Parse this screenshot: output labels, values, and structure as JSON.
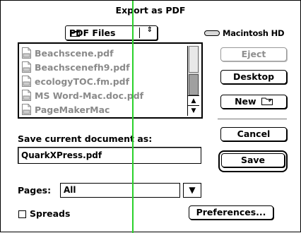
{
  "dialog": {
    "title": "Export as PDF",
    "folder_popup": {
      "selected": "PDF Files",
      "arrows": "⇕"
    },
    "volume": {
      "name": "Macintosh HD"
    },
    "files": [
      {
        "name": "Beachscene.pdf",
        "icon": "pdf-file-icon"
      },
      {
        "name": "Beachscenefh9.pdf",
        "icon": "pdf-file-icon"
      },
      {
        "name": "ecologyTOC.fm.pdf",
        "icon": "pdf-file-icon"
      },
      {
        "name": "MS Word-Mac.doc.pdf",
        "icon": "pdf-file-icon"
      },
      {
        "name": "PageMakerMac",
        "icon": "pdf-file-icon"
      }
    ],
    "buttons": {
      "eject": "Eject",
      "desktop": "Desktop",
      "new": "New",
      "cancel": "Cancel",
      "save": "Save",
      "preferences": "Preferences..."
    },
    "save_as_label": "Save current document as:",
    "save_as_value": "QuarkXPress.pdf",
    "pages_label": "Pages:",
    "pages_value": "All",
    "spreads_label": "Spreads",
    "scroll_up": "▲",
    "scroll_down": "▼",
    "select_arrow": "▼"
  },
  "colors": {
    "disabled_text": "#8a8a8a",
    "overlay_line": "#2bd12b"
  }
}
